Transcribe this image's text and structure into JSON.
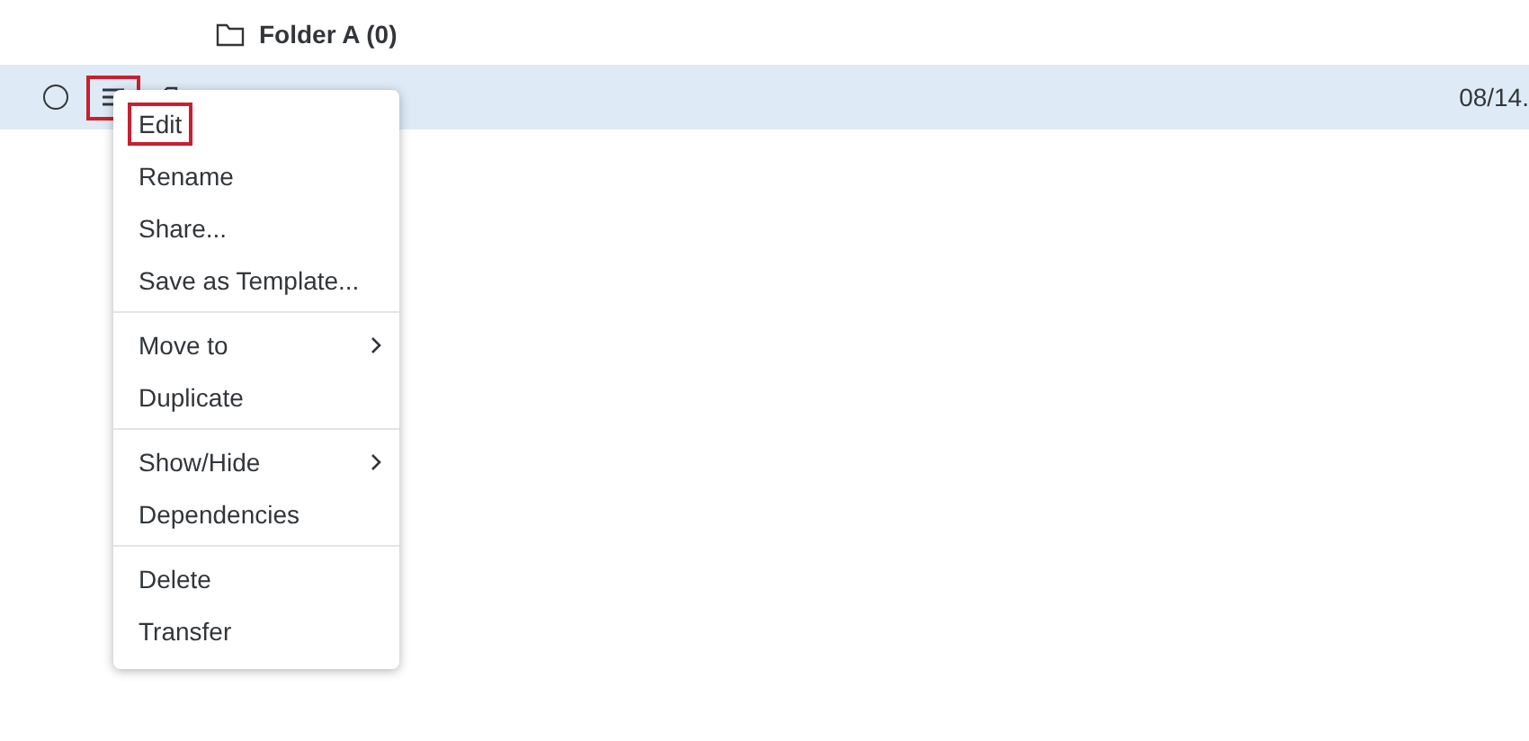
{
  "folder": {
    "label": "Folder A (0)"
  },
  "row": {
    "selected": true,
    "checked": false,
    "menu_highlighted": true,
    "date": "08/14."
  },
  "menu": {
    "groups": [
      [
        {
          "label": "Edit",
          "highlighted": true,
          "submenu": false
        },
        {
          "label": "Rename",
          "highlighted": false,
          "submenu": false
        },
        {
          "label": "Share...",
          "highlighted": false,
          "submenu": false
        },
        {
          "label": "Save as Template...",
          "highlighted": false,
          "submenu": false
        }
      ],
      [
        {
          "label": "Move to",
          "highlighted": false,
          "submenu": true
        },
        {
          "label": "Duplicate",
          "highlighted": false,
          "submenu": false
        }
      ],
      [
        {
          "label": "Show/Hide",
          "highlighted": false,
          "submenu": true
        },
        {
          "label": "Dependencies",
          "highlighted": false,
          "submenu": false
        }
      ],
      [
        {
          "label": "Delete",
          "highlighted": false,
          "submenu": false
        },
        {
          "label": "Transfer",
          "highlighted": false,
          "submenu": false
        }
      ]
    ]
  }
}
